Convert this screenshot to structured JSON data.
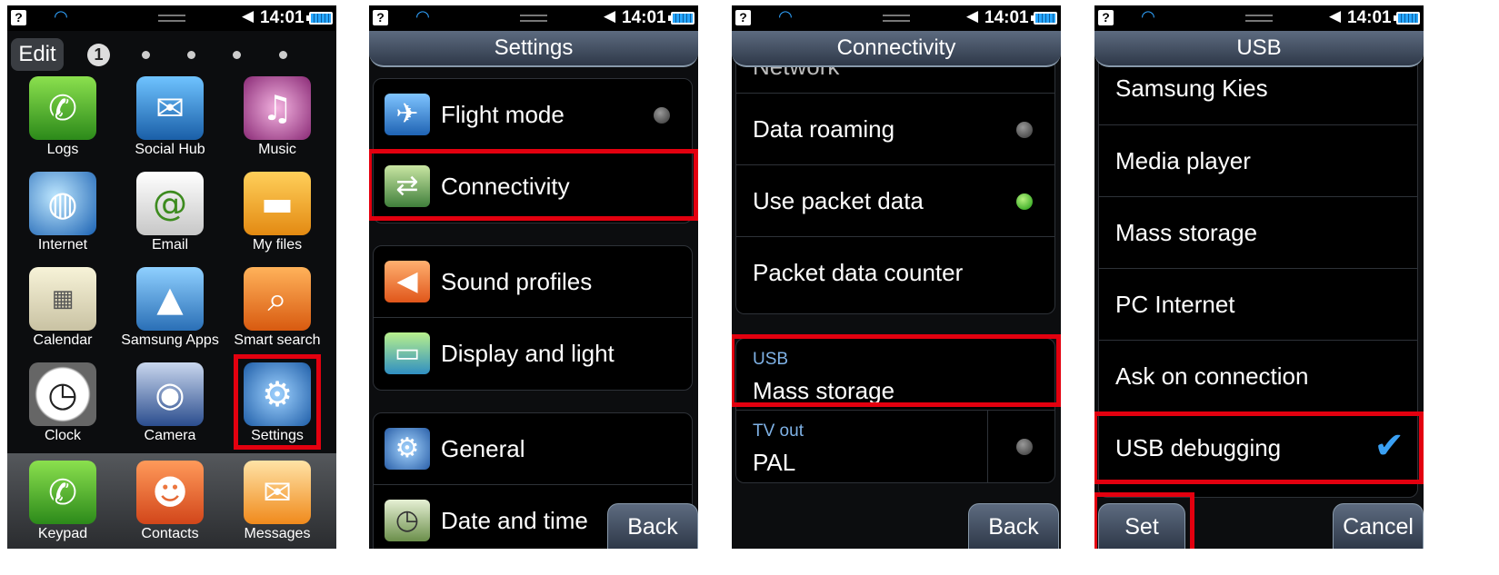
{
  "status": {
    "time": "14:01",
    "help_icon": "help-icon",
    "wifi_icon": "wifi-icon",
    "volume_icon": "volume-icon",
    "battery_icon": "battery-icon"
  },
  "home": {
    "edit_label": "Edit",
    "page_number": "1",
    "apps": [
      {
        "label": "Logs",
        "icon": "logs-icon"
      },
      {
        "label": "Social Hub",
        "icon": "social-hub-icon"
      },
      {
        "label": "Music",
        "icon": "music-icon"
      },
      {
        "label": "Internet",
        "icon": "internet-icon"
      },
      {
        "label": "Email",
        "icon": "email-icon"
      },
      {
        "label": "My files",
        "icon": "folder-icon"
      },
      {
        "label": "Calendar",
        "icon": "calendar-icon"
      },
      {
        "label": "Samsung Apps",
        "icon": "samsung-apps-icon"
      },
      {
        "label": "Smart search",
        "icon": "search-icon"
      },
      {
        "label": "Clock",
        "icon": "clock-icon"
      },
      {
        "label": "Camera",
        "icon": "camera-icon"
      },
      {
        "label": "Settings",
        "icon": "gear-icon"
      }
    ],
    "dock": [
      {
        "label": "Keypad",
        "icon": "phone-icon"
      },
      {
        "label": "Contacts",
        "icon": "contacts-icon"
      },
      {
        "label": "Messages",
        "icon": "message-icon"
      }
    ]
  },
  "settings": {
    "title": "Settings",
    "items": [
      {
        "label": "Flight mode",
        "icon": "airplane-icon"
      },
      {
        "label": "Connectivity",
        "icon": "connectivity-icon"
      },
      {
        "label": "Sound profiles",
        "icon": "speaker-icon"
      },
      {
        "label": "Display and light",
        "icon": "monitor-icon"
      },
      {
        "label": "General",
        "icon": "gear-icon"
      },
      {
        "label": "Date and time",
        "icon": "calendar-clock-icon"
      }
    ],
    "back_label": "Back"
  },
  "connectivity": {
    "title": "Connectivity",
    "partial_label": "Network",
    "items": [
      {
        "label": "Data roaming",
        "toggle": "off"
      },
      {
        "label": "Use packet data",
        "toggle": "on"
      },
      {
        "label": "Packet data counter"
      }
    ],
    "usb": {
      "label": "USB",
      "value": "Mass storage"
    },
    "tv_out": {
      "label": "TV out",
      "value": "PAL"
    },
    "back_label": "Back"
  },
  "usb": {
    "title": "USB",
    "options": [
      {
        "label": "Samsung Kies"
      },
      {
        "label": "Media player"
      },
      {
        "label": "Mass storage"
      },
      {
        "label": "PC Internet"
      },
      {
        "label": "Ask on connection"
      },
      {
        "label": "USB debugging",
        "selected": true
      }
    ],
    "set_label": "Set",
    "cancel_label": "Cancel"
  },
  "colors": {
    "highlight": "#e3000f",
    "accent": "#3aa0f3",
    "toggle_on": "#1a9a0f"
  }
}
